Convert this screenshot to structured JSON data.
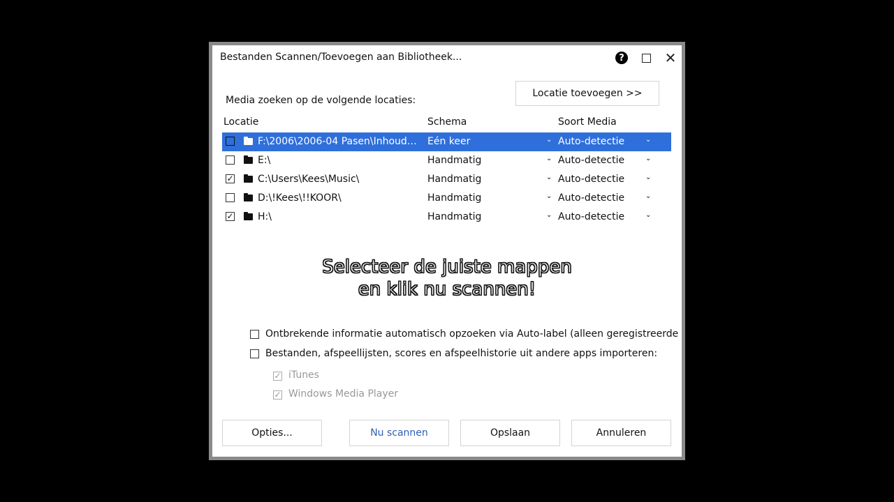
{
  "dialog": {
    "title": "Bestanden Scannen/Toevoegen aan Bibliotheek...",
    "help_glyph": "?",
    "close_glyph": "✕"
  },
  "intro": "Media zoeken op de volgende locaties:",
  "add_location_label": "Locatie toevoegen >>",
  "columns": {
    "location": "Locatie",
    "schema": "Schema",
    "media": "Soort Media"
  },
  "rows": [
    {
      "path": "F:\\2006\\2006-04 Pasen\\Inhoud\\...",
      "schema": "Eén keer",
      "media": "Auto-detectie",
      "checked": false,
      "selected": true
    },
    {
      "path": "E:\\",
      "schema": "Handmatig",
      "media": "Auto-detectie",
      "checked": false,
      "selected": false
    },
    {
      "path": "C:\\Users\\Kees\\Music\\",
      "schema": "Handmatig",
      "media": "Auto-detectie",
      "checked": true,
      "selected": false
    },
    {
      "path": "D:\\!Kees\\!!KOOR\\",
      "schema": "Handmatig",
      "media": "Auto-detectie",
      "checked": false,
      "selected": false
    },
    {
      "path": "H:\\",
      "schema": "Handmatig",
      "media": "Auto-detectie",
      "checked": true,
      "selected": false
    }
  ],
  "caption": {
    "line1": "Selecteer de juiste mappen",
    "line2": "en klik nu scannen!"
  },
  "options": {
    "auto_label": "Ontbrekende informatie automatisch opzoeken via Auto-label (alleen geregistreerde g",
    "import": "Bestanden, afspeellijsten, scores en afspeelhistorie uit andere apps importeren:",
    "itunes": "iTunes",
    "wmp": "Windows Media Player"
  },
  "buttons": {
    "options": "Opties...",
    "scan": "Nu scannen",
    "save": "Opslaan",
    "cancel": "Annuleren"
  },
  "glyphs": {
    "check": "✓",
    "dropdown": "⌄"
  },
  "colors": {
    "selection": "#2f6fdb",
    "primary_text": "#2f5fb3"
  }
}
